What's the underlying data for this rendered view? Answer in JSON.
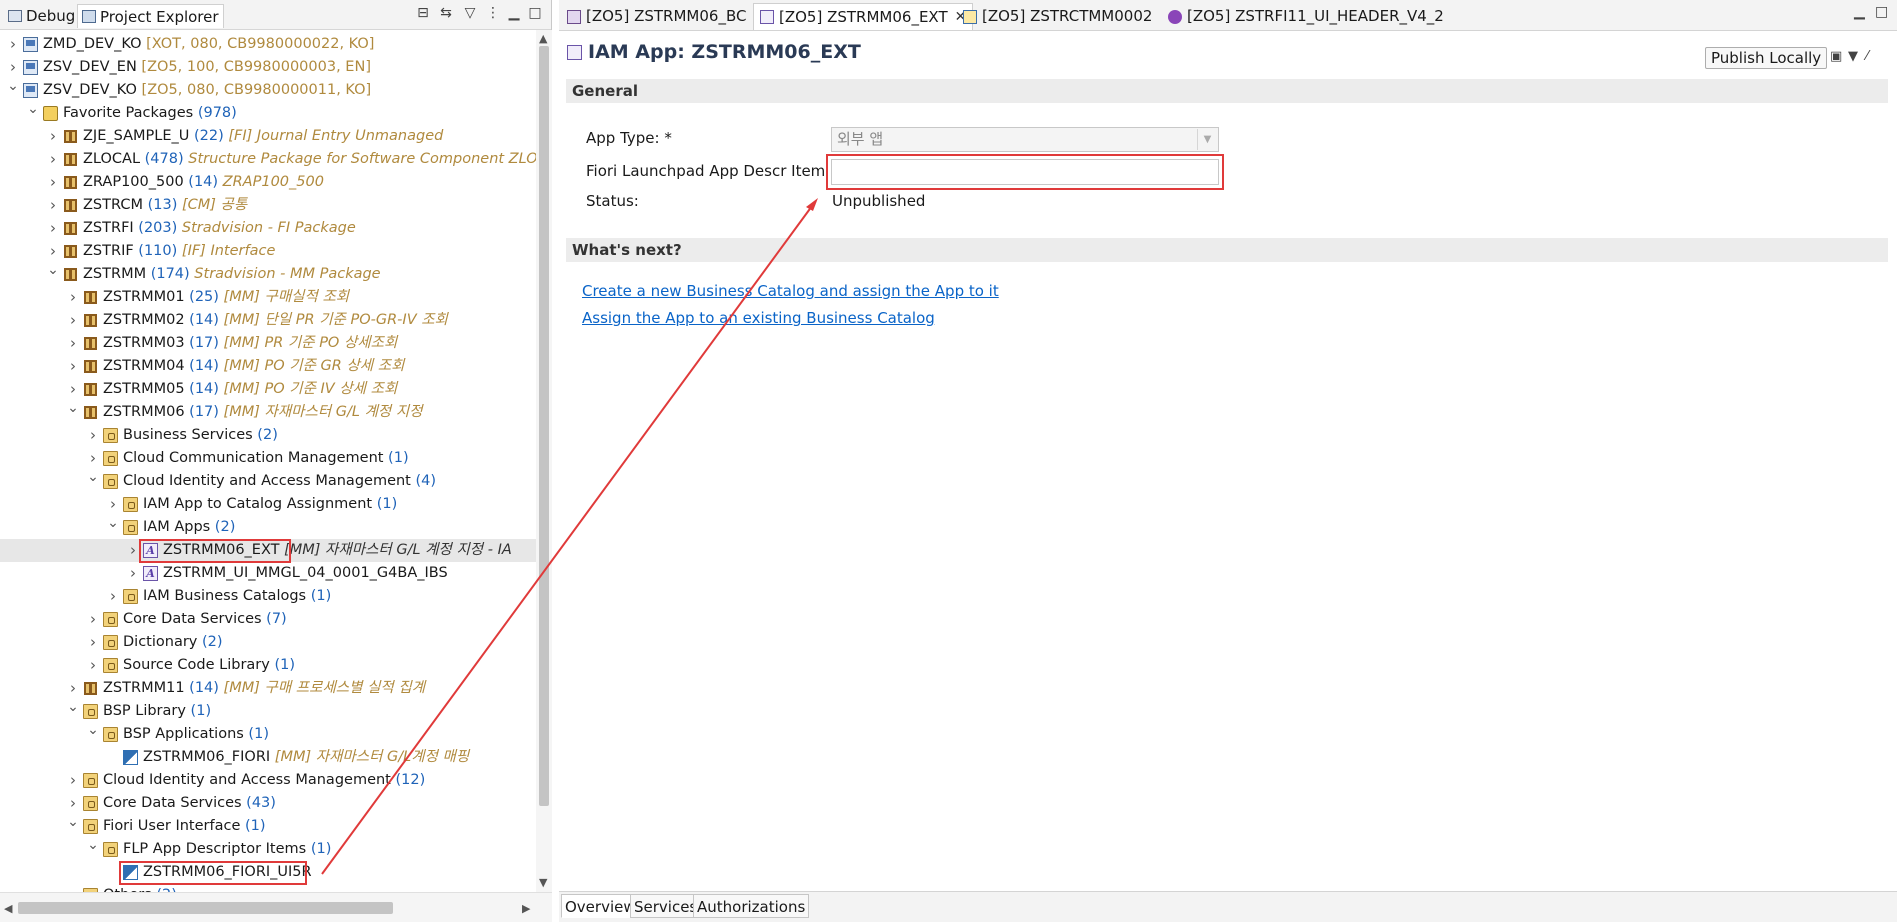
{
  "left_panel": {
    "tabs": [
      {
        "label": "Debug",
        "icon": "debug-icon",
        "active": false
      },
      {
        "label": "Project Explorer",
        "icon": "project-explorer-icon",
        "active": true
      }
    ],
    "tree": [
      {
        "level": 0,
        "toggle": "closed",
        "icon": "system",
        "label": "ZMD_DEV_KO",
        "desc": "[XOT, 080, CB9980000022, KO]"
      },
      {
        "level": 0,
        "toggle": "closed",
        "icon": "system",
        "label": "ZSV_DEV_EN",
        "desc": "[ZO5, 100, CB9980000003, EN]"
      },
      {
        "level": 0,
        "toggle": "open",
        "icon": "system",
        "label": "ZSV_DEV_KO",
        "desc": "[ZO5, 080, CB9980000011, KO]"
      },
      {
        "level": 1,
        "toggle": "open",
        "icon": "fav",
        "label": "Favorite Packages",
        "count": "(978)"
      },
      {
        "level": 2,
        "toggle": "closed",
        "icon": "pkg",
        "label": "ZJE_SAMPLE_U",
        "count": "(22)",
        "desc": "[FI] Journal Entry Unmanaged"
      },
      {
        "level": 2,
        "toggle": "closed",
        "icon": "pkg",
        "label": "ZLOCAL",
        "count": "(478)",
        "desc": "Structure Package for Software Component ZLOC"
      },
      {
        "level": 2,
        "toggle": "closed",
        "icon": "pkg",
        "label": "ZRAP100_500",
        "count": "(14)",
        "desc": "ZRAP100_500"
      },
      {
        "level": 2,
        "toggle": "closed",
        "icon": "pkg",
        "label": "ZSTRCM",
        "count": "(13)",
        "desc": "[CM] 공통"
      },
      {
        "level": 2,
        "toggle": "closed",
        "icon": "pkg",
        "label": "ZSTRFI",
        "count": "(203)",
        "desc": "Stradvision - FI Package"
      },
      {
        "level": 2,
        "toggle": "closed",
        "icon": "pkg",
        "label": "ZSTRIF",
        "count": "(110)",
        "desc": "[IF] Interface"
      },
      {
        "level": 2,
        "toggle": "open",
        "icon": "pkg",
        "label": "ZSTRMM",
        "count": "(174)",
        "desc": "Stradvision - MM Package"
      },
      {
        "level": 3,
        "toggle": "closed",
        "icon": "pkg",
        "label": "ZSTRMM01",
        "count": "(25)",
        "desc": "[MM] 구매실적 조회"
      },
      {
        "level": 3,
        "toggle": "closed",
        "icon": "pkg",
        "label": "ZSTRMM02",
        "count": "(14)",
        "desc": "[MM] 단일 PR 기준 PO-GR-IV 조회"
      },
      {
        "level": 3,
        "toggle": "closed",
        "icon": "pkg",
        "label": "ZSTRMM03",
        "count": "(17)",
        "desc": "[MM] PR 기준 PO 상세조회"
      },
      {
        "level": 3,
        "toggle": "closed",
        "icon": "pkg",
        "label": "ZSTRMM04",
        "count": "(14)",
        "desc": "[MM] PO 기준 GR 상세 조회"
      },
      {
        "level": 3,
        "toggle": "closed",
        "icon": "pkg",
        "label": "ZSTRMM05",
        "count": "(14)",
        "desc": "[MM] PO 기준 IV 상세 조회"
      },
      {
        "level": 3,
        "toggle": "open",
        "icon": "pkg",
        "label": "ZSTRMM06",
        "count": "(17)",
        "desc": "[MM] 자재마스터 G/L 계정 지정"
      },
      {
        "level": 4,
        "toggle": "closed",
        "icon": "folder",
        "label": "Business Services",
        "count": "(2)"
      },
      {
        "level": 4,
        "toggle": "closed",
        "icon": "folder",
        "label": "Cloud Communication Management",
        "count": "(1)"
      },
      {
        "level": 4,
        "toggle": "open",
        "icon": "folder",
        "label": "Cloud Identity and Access Management",
        "count": "(4)"
      },
      {
        "level": 5,
        "toggle": "closed",
        "icon": "folder",
        "label": "IAM App to Catalog Assignment",
        "count": "(1)"
      },
      {
        "level": 5,
        "toggle": "open",
        "icon": "folder",
        "label": "IAM Apps",
        "count": "(2)"
      },
      {
        "level": 6,
        "toggle": "closed",
        "icon": "iam",
        "label": "ZSTRMM06_EXT",
        "desc": "[MM] 자재마스터 G/L 계정 지정 - IA",
        "selected": true
      },
      {
        "level": 6,
        "toggle": "closed",
        "icon": "iam",
        "label": "ZSTRMM_UI_MMGL_04_0001_G4BA_IBS"
      },
      {
        "level": 5,
        "toggle": "closed",
        "icon": "folder",
        "label": "IAM Business Catalogs",
        "count": "(1)"
      },
      {
        "level": 4,
        "toggle": "closed",
        "icon": "folder",
        "label": "Core Data Services",
        "count": "(7)"
      },
      {
        "level": 4,
        "toggle": "closed",
        "icon": "folder",
        "label": "Dictionary",
        "count": "(2)"
      },
      {
        "level": 4,
        "toggle": "closed",
        "icon": "folder",
        "label": "Source Code Library",
        "count": "(1)"
      },
      {
        "level": 3,
        "toggle": "closed",
        "icon": "pkg",
        "label": "ZSTRMM11",
        "count": "(14)",
        "desc": "[MM] 구매 프로세스별 실적 집계"
      },
      {
        "level": 3,
        "toggle": "open",
        "icon": "folder",
        "label": "BSP Library",
        "count": "(1)"
      },
      {
        "level": 4,
        "toggle": "open",
        "icon": "folder",
        "label": "BSP Applications",
        "count": "(1)"
      },
      {
        "level": 5,
        "toggle": "none",
        "icon": "bsp",
        "label": "ZSTRMM06_FIORI",
        "desc": "[MM] 자재마스터 G/L계정 매핑"
      },
      {
        "level": 3,
        "toggle": "closed",
        "icon": "folder",
        "label": "Cloud Identity and Access Management",
        "count": "(12)"
      },
      {
        "level": 3,
        "toggle": "closed",
        "icon": "folder",
        "label": "Core Data Services",
        "count": "(43)"
      },
      {
        "level": 3,
        "toggle": "open",
        "icon": "folder",
        "label": "Fiori User Interface",
        "count": "(1)"
      },
      {
        "level": 4,
        "toggle": "open",
        "icon": "folder",
        "label": "FLP App Descriptor Items",
        "count": "(1)"
      },
      {
        "level": 5,
        "toggle": "none",
        "icon": "bsp",
        "label": "ZSTRMM06_FIORI_UI5R"
      },
      {
        "level": 3,
        "toggle": "closed",
        "icon": "folder",
        "label": "Others",
        "count": "(2)"
      }
    ]
  },
  "editor_tabs": [
    {
      "label": "[ZO5] ZSTRMM06_BC",
      "icon": "business-catalog-icon",
      "active": false
    },
    {
      "label": "[ZO5] ZSTRMM06_EXT",
      "icon": "iam-app-icon",
      "active": true
    },
    {
      "label": "[ZO5] ZSTRCTMM0002",
      "icon": "catalog-icon",
      "active": false
    },
    {
      "label": "[ZO5] ZSTRFI11_UI_HEADER_V4_2",
      "icon": "ui5-icon",
      "active": false
    }
  ],
  "editor": {
    "title": "IAM App: ZSTRMM06_EXT",
    "publish_label": "Publish Locally",
    "general_section": "General",
    "app_type_label": "App Type: *",
    "app_type_value": "외부 앱",
    "fiori_label": "Fiori Launchpad App Descr Item ID:",
    "fiori_value": "",
    "status_label": "Status:",
    "status_value": "Unpublished",
    "whats_next_section": "What's next?",
    "links": [
      "Create a new Business Catalog and assign the App to it",
      "Assign the App to an existing Business Catalog"
    ]
  },
  "bottom_tabs": [
    {
      "label": "Overview",
      "active": true
    },
    {
      "label": "Services",
      "active": false
    },
    {
      "label": "Authorizations",
      "active": false
    }
  ],
  "annotation_color": "#e03a3a"
}
